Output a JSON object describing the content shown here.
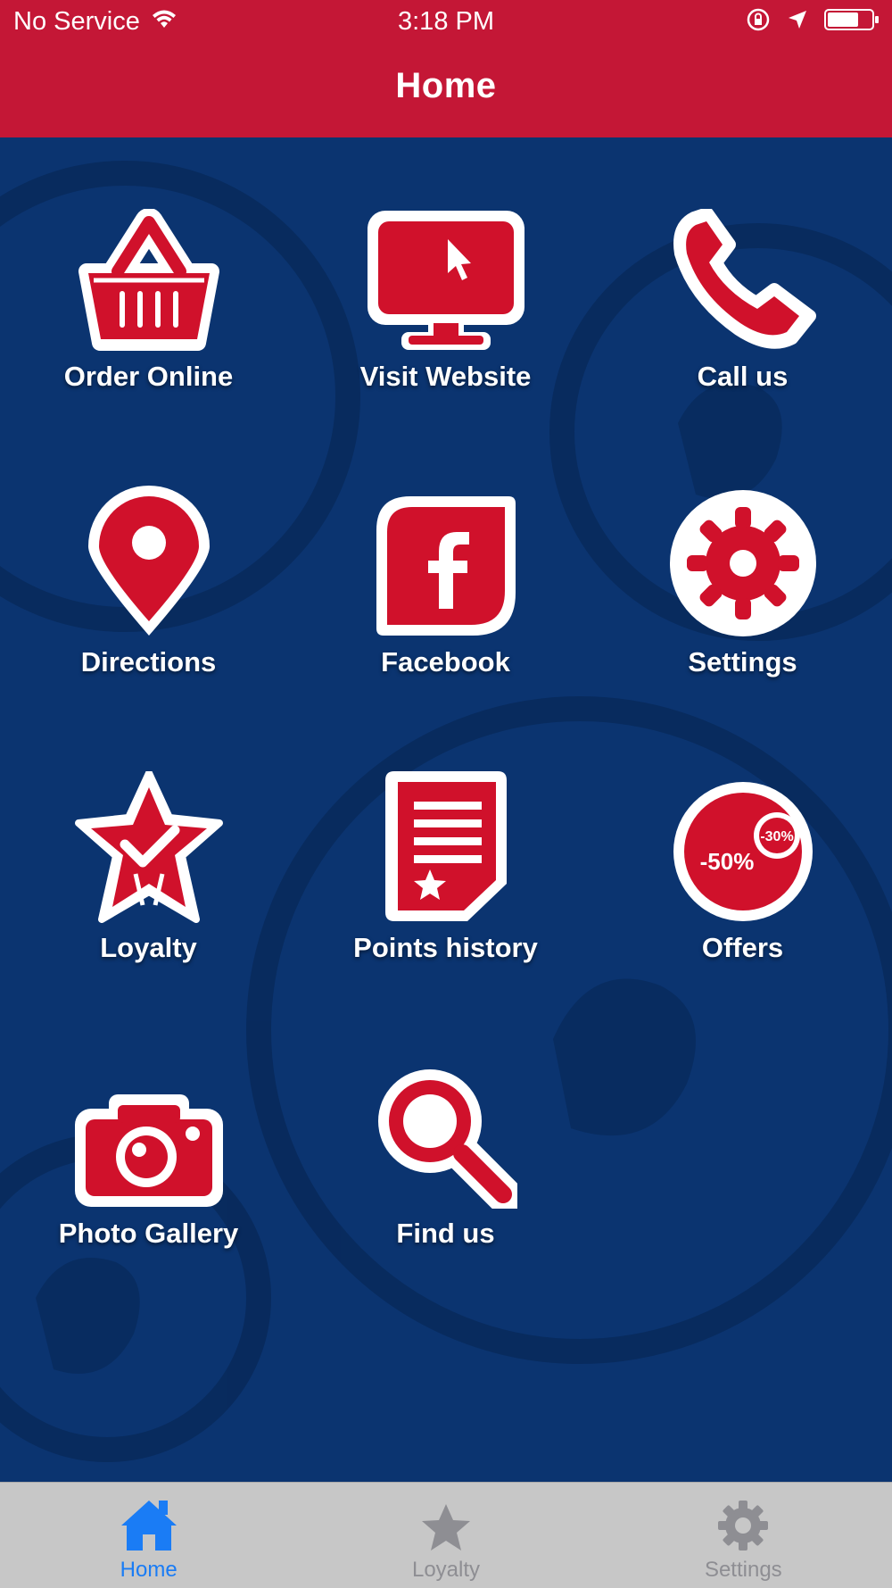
{
  "status_bar": {
    "carrier": "No Service",
    "time": "3:18 PM"
  },
  "nav": {
    "title": "Home"
  },
  "tiles": [
    {
      "label": "Order Online",
      "icon": "basket-icon"
    },
    {
      "label": "Visit Website",
      "icon": "monitor-icon"
    },
    {
      "label": "Call us",
      "icon": "phone-icon"
    },
    {
      "label": "Directions",
      "icon": "map-pin-icon"
    },
    {
      "label": "Facebook",
      "icon": "facebook-icon"
    },
    {
      "label": "Settings",
      "icon": "gear-icon"
    },
    {
      "label": "Loyalty",
      "icon": "loyalty-star-icon"
    },
    {
      "label": "Points history",
      "icon": "receipt-icon"
    },
    {
      "label": "Offers",
      "icon": "offers-icon",
      "badge_large": "-50%",
      "badge_small": "-30%"
    },
    {
      "label": "Photo Gallery",
      "icon": "camera-icon"
    },
    {
      "label": "Find us",
      "icon": "magnifier-icon"
    }
  ],
  "tabbar": {
    "items": [
      {
        "label": "Home",
        "icon": "home-icon",
        "active": true
      },
      {
        "label": "Loyalty",
        "icon": "star-icon",
        "active": false
      },
      {
        "label": "Settings",
        "icon": "gear-icon",
        "active": false
      }
    ]
  },
  "colors": {
    "brand_red": "#c41736",
    "icon_red": "#d0112b",
    "background_blue": "#0b3470",
    "active_tab_blue": "#1a7cf5"
  }
}
